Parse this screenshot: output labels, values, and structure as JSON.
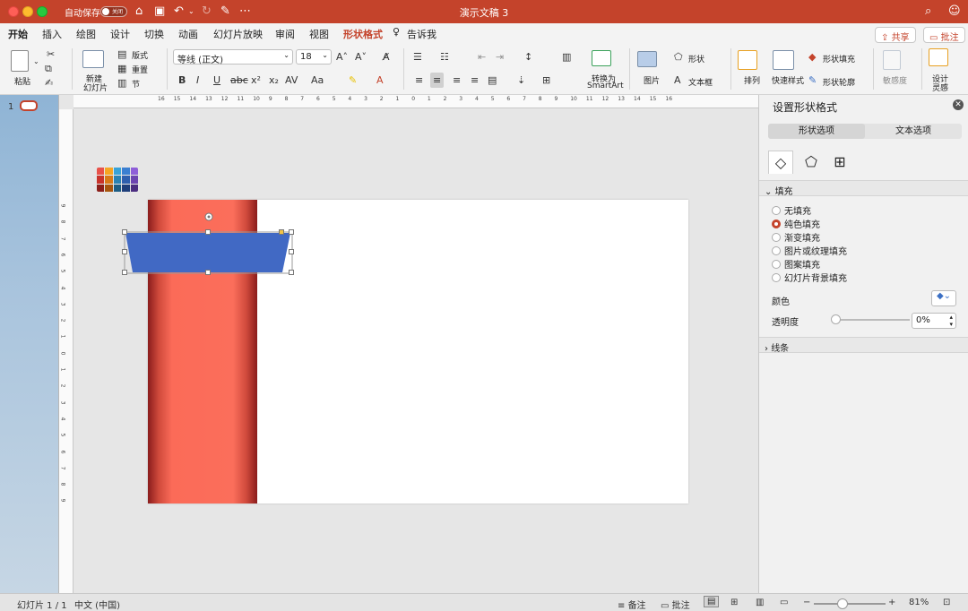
{
  "titlebar": {
    "autosave_label": "自动保存",
    "autosave_state": "关闭",
    "doc_title": "演示文稿 3"
  },
  "tabs": [
    "开始",
    "插入",
    "绘图",
    "设计",
    "切换",
    "动画",
    "幻灯片放映",
    "审阅",
    "视图",
    "形状格式",
    "告诉我"
  ],
  "share": {
    "share_label": "共享",
    "comments_label": "批注"
  },
  "ribbon": {
    "paste": "粘贴",
    "new_slide_l1": "新建",
    "new_slide_l2": "幻灯片",
    "layout": "版式",
    "reset": "重置",
    "section": "节",
    "font_name": "等线 (正文)",
    "font_size": "18",
    "convert_l1": "转换为",
    "convert_l2": "SmartArt",
    "picture": "图片",
    "shape": "形状",
    "textbox": "文本框",
    "arrange": "排列",
    "quick_styles": "快速样式",
    "shape_fill": "形状填充",
    "shape_outline": "形状轮廓",
    "sensitivity": "敏感度",
    "designer_l1": "设计",
    "designer_l2": "灵感"
  },
  "thumbnails": {
    "slide_number": "1"
  },
  "ruler": {
    "h_ticks": [
      "16",
      "15",
      "14",
      "13",
      "12",
      "11",
      "10",
      "9",
      "8",
      "7",
      "6",
      "5",
      "4",
      "3",
      "2",
      "1",
      "0",
      "1",
      "2",
      "3",
      "4",
      "5",
      "6",
      "7",
      "8",
      "9",
      "10",
      "11",
      "12",
      "13",
      "14",
      "15",
      "16"
    ],
    "v_ticks": [
      "9",
      "8",
      "7",
      "6",
      "5",
      "4",
      "3",
      "2",
      "1",
      "0",
      "1",
      "2",
      "3",
      "4",
      "5",
      "6",
      "7",
      "8",
      "9"
    ]
  },
  "palette_colors": [
    "#e8524a",
    "#f6a623",
    "#38a3d8",
    "#3b7fd1",
    "#8e5ed8",
    "#c8332b",
    "#d97a17",
    "#2a82b3",
    "#2f5fae",
    "#6c44b0",
    "#8c1f1a",
    "#a8550d",
    "#1d5d84",
    "#1f3f7b",
    "#4b2d80"
  ],
  "format_pane": {
    "title": "设置形状格式",
    "tab_shape": "形状选项",
    "tab_text": "文本选项",
    "fill_section": "填充",
    "fill_options": [
      "无填充",
      "纯色填充",
      "渐变填充",
      "图片或纹理填充",
      "图案填充",
      "幻灯片背景填充"
    ],
    "selected_fill": 1,
    "color_label": "颜色",
    "transparency_label": "透明度",
    "transparency_value": "0%",
    "line_section": "线条"
  },
  "statusbar": {
    "slide_info": "幻灯片 1 / 1",
    "language": "中文 (中国)",
    "notes": "备注",
    "comments": "批注",
    "zoom": "81%"
  },
  "colors": {
    "accent": "#c4432b",
    "shape_blue": "#4169c4",
    "bar_red": "#fb6b58"
  }
}
